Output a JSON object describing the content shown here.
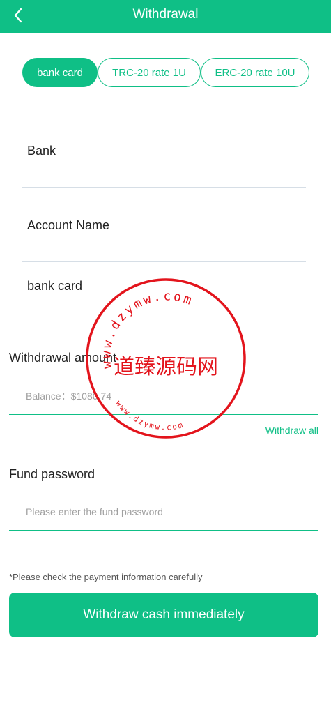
{
  "header": {
    "title": "Withdrawal",
    "back_icon": "chevron-left-icon"
  },
  "tabs": [
    {
      "label": "bank card",
      "active": true
    },
    {
      "label": "TRC-20 rate 1U",
      "active": false
    },
    {
      "label": "ERC-20 rate 10U",
      "active": false
    }
  ],
  "fields": {
    "bank": {
      "label": "Bank",
      "value": ""
    },
    "account_name": {
      "label": "Account Name",
      "value": ""
    },
    "bank_card": {
      "label": "bank card",
      "value": ""
    }
  },
  "amount": {
    "label": "Withdrawal amount",
    "placeholder": "Balance：$1080.74",
    "withdraw_all": "Withdraw all"
  },
  "fund_password": {
    "label": "Fund password",
    "placeholder": "Please enter the fund password"
  },
  "note": "*Please check the payment information carefully",
  "submit_label": "Withdraw cash immediately",
  "watermark": {
    "center_text": "道臻源码网",
    "top_arc": "www.dzymw.com",
    "bottom_arc": "www.dzymw.com",
    "color": "#e3141c"
  },
  "colors": {
    "accent": "#0fbf86"
  }
}
